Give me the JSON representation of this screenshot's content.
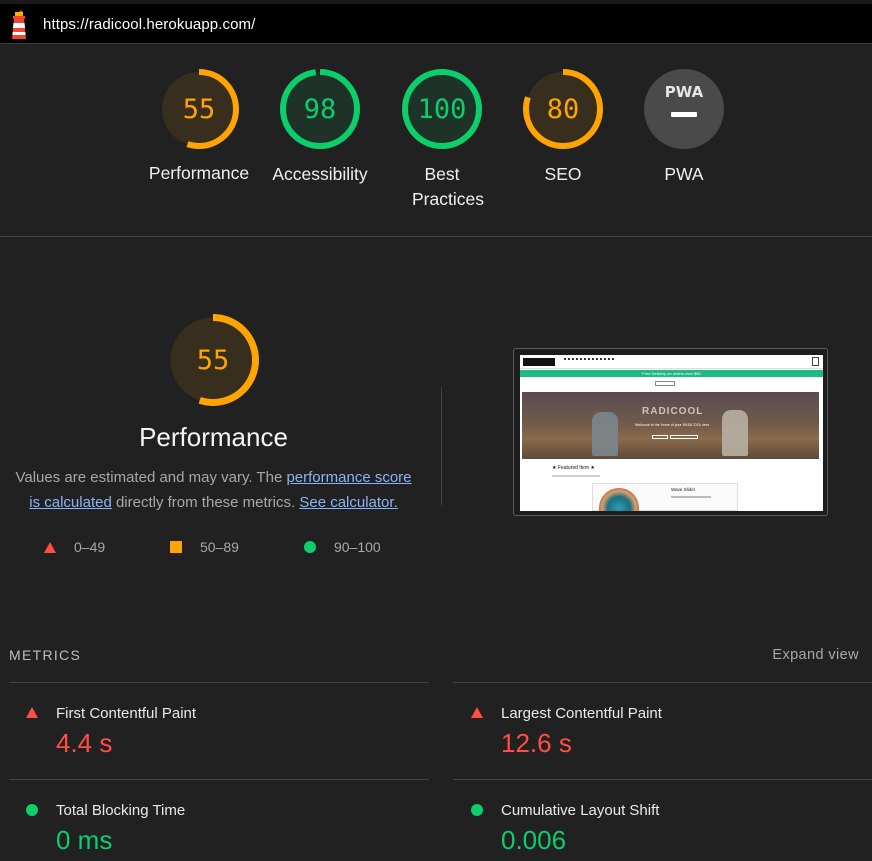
{
  "browser": {
    "url": "https://radicool.herokuapp.com/",
    "logo_icon": "lighthouse-icon"
  },
  "colors": {
    "pass": "#0cce6b",
    "average": "#ffa400",
    "fail": "#ff4e42",
    "neutral": "#4a4a4a"
  },
  "scores": [
    {
      "label": "Performance",
      "value": "55",
      "score": 55,
      "rating": "average"
    },
    {
      "label": "Accessibility",
      "value": "98",
      "score": 98,
      "rating": "pass"
    },
    {
      "label": "Best Practices",
      "value": "100",
      "score": 100,
      "rating": "pass"
    },
    {
      "label": "SEO",
      "value": "80",
      "score": 80,
      "rating": "average"
    },
    {
      "label": "PWA",
      "value": "PWA",
      "rating": "neutral"
    }
  ],
  "performance": {
    "score": "55",
    "title": "Performance",
    "desc_prefix": "Values are estimated and may vary. The ",
    "link_score": "performance score is calculated",
    "desc_middle": " directly from these metrics. ",
    "link_calculator": "See calculator.",
    "legend": [
      {
        "range": "0–49"
      },
      {
        "range": "50–89"
      },
      {
        "range": "90–100"
      }
    ]
  },
  "screenshot_preview": {
    "banner": "Free Delivery on orders over $50",
    "hero_title": "RADICOOL",
    "hero_subtitle": "Welcome to the home of your RADICOOL tees",
    "featured": "Featured Item",
    "product": "Wave Slider"
  },
  "metrics": {
    "heading": "METRICS",
    "expand_label": "Expand view",
    "items": [
      {
        "label": "First Contentful Paint",
        "value": "4.4 s",
        "rating": "fail"
      },
      {
        "label": "Largest Contentful Paint",
        "value": "12.6 s",
        "rating": "fail"
      },
      {
        "label": "Total Blocking Time",
        "value": "0 ms",
        "rating": "pass"
      },
      {
        "label": "Cumulative Layout Shift",
        "value": "0.006",
        "rating": "pass"
      }
    ]
  }
}
